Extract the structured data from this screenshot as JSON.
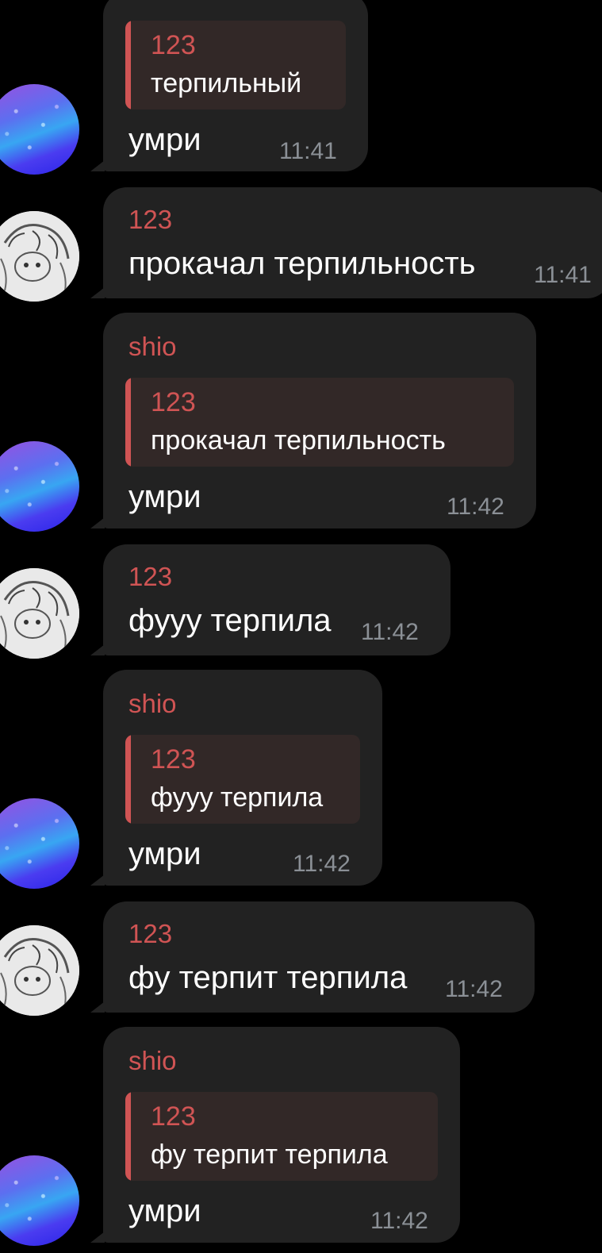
{
  "messages": [
    {
      "sender": "",
      "quote": {
        "author": "123",
        "text": "терпильный"
      },
      "text": "умри",
      "time": "11:41",
      "avatar": "sparkle-avatar"
    },
    {
      "sender": "123",
      "quote": null,
      "text": "прокачал терпильность",
      "time": "11:41",
      "avatar": "sketch-avatar"
    },
    {
      "sender": "shio",
      "quote": {
        "author": "123",
        "text": "прокачал терпильность"
      },
      "text": "умри",
      "time": "11:42",
      "avatar": "sparkle-avatar"
    },
    {
      "sender": "123",
      "quote": null,
      "text": "фууу терпила",
      "time": "11:42",
      "avatar": "sketch-avatar"
    },
    {
      "sender": "shio",
      "quote": {
        "author": "123",
        "text": "фууу терпила"
      },
      "text": "умри",
      "time": "11:42",
      "avatar": "sparkle-avatar"
    },
    {
      "sender": "123",
      "quote": null,
      "text": "фу терпит терпила",
      "time": "11:42",
      "avatar": "sketch-avatar"
    },
    {
      "sender": "shio",
      "quote": {
        "author": "123",
        "text": "фу терпит терпила"
      },
      "text": "умри",
      "time": "11:42",
      "avatar": "sparkle-avatar"
    }
  ],
  "colors": {
    "background": "#000000",
    "bubble": "#222222",
    "accent": "#d05454",
    "quote_bg": "#322827",
    "time": "#8b9096"
  }
}
